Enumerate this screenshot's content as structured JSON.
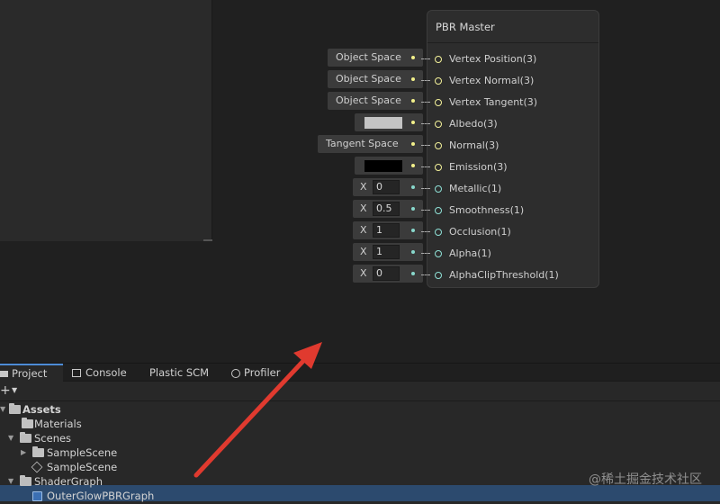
{
  "master_node": {
    "title": "PBR Master",
    "ports": [
      {
        "label": "Vertex Position(3)",
        "input": {
          "type": "dropdown",
          "value": "Object Space"
        }
      },
      {
        "label": "Vertex Normal(3)",
        "input": {
          "type": "dropdown",
          "value": "Object Space"
        }
      },
      {
        "label": "Vertex Tangent(3)",
        "input": {
          "type": "dropdown",
          "value": "Object Space"
        }
      },
      {
        "label": "Albedo(3)",
        "input": {
          "type": "color",
          "value": "#c4c4c4"
        }
      },
      {
        "label": "Normal(3)",
        "input": {
          "type": "dropdown",
          "value": "Tangent Space"
        }
      },
      {
        "label": "Emission(3)",
        "input": {
          "type": "color",
          "value": "#000000"
        }
      },
      {
        "label": "Metallic(1)",
        "input": {
          "type": "number",
          "axis": "X",
          "value": "0"
        }
      },
      {
        "label": "Smoothness(1)",
        "input": {
          "type": "number",
          "axis": "X",
          "value": "0.5"
        }
      },
      {
        "label": "Occlusion(1)",
        "input": {
          "type": "number",
          "axis": "X",
          "value": "1"
        }
      },
      {
        "label": "Alpha(1)",
        "input": {
          "type": "number",
          "axis": "X",
          "value": "1"
        }
      },
      {
        "label": "AlphaClipThreshold(1)",
        "input": {
          "type": "number",
          "axis": "X",
          "value": "0"
        }
      }
    ]
  },
  "tabs": [
    {
      "label": "Project",
      "icon": "folder-icon",
      "active": true
    },
    {
      "label": "Console",
      "icon": "console-icon",
      "active": false
    },
    {
      "label": "Plastic SCM",
      "icon": "",
      "active": false
    },
    {
      "label": "Profiler",
      "icon": "profiler-icon",
      "active": false
    }
  ],
  "toolbar": {
    "add": "+"
  },
  "tree": [
    {
      "label": "Assets",
      "bold": true
    },
    {
      "label": "Materials"
    },
    {
      "label": "Scenes"
    },
    {
      "label": "SampleScene"
    },
    {
      "label": "SampleScene"
    },
    {
      "label": "ShaderGraph"
    },
    {
      "label": "OuterGlowPBRGraph"
    }
  ],
  "watermark": "@稀土掘金技术社区",
  "colors": {
    "accent": "#4d8bd6",
    "arrow": "#e03a2f",
    "selection": "#2c4a6e"
  }
}
